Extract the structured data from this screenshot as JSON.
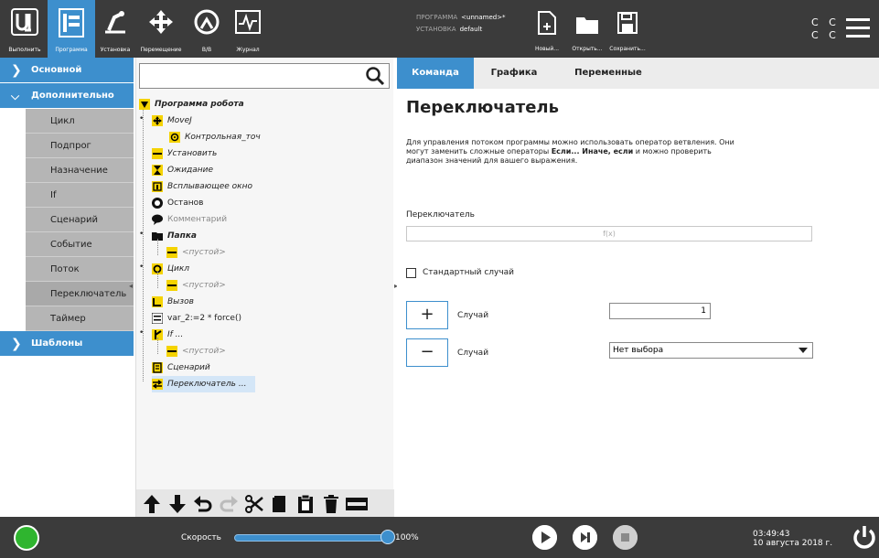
{
  "topnav": {
    "items": [
      {
        "label": "Выполнить",
        "icon": "ur-logo-icon"
      },
      {
        "label": "Программа",
        "icon": "program-icon",
        "active": true
      },
      {
        "label": "Установка",
        "icon": "installation-icon"
      },
      {
        "label": "Перемещение",
        "icon": "move-icon"
      },
      {
        "label": "В/В",
        "icon": "io-icon"
      },
      {
        "label": "Журнал",
        "icon": "log-icon"
      }
    ],
    "program_label": "ПРОГРАММА",
    "program_value": "<unnamed>*",
    "install_label": "УСТАНОВКА",
    "install_value": "default",
    "new_label": "Новый...",
    "open_label": "Открыть...",
    "save_label": "Сохранить...",
    "cc_line1": "C C",
    "cc_line2": "C C"
  },
  "sidebar": {
    "cat_basic": "Основной",
    "cat_advanced": "Дополнительно",
    "advanced_items": [
      "Цикл",
      "Подпрог",
      "Назначение",
      "If",
      "Сценарий",
      "Событие",
      "Поток",
      "Переключатель",
      "Таймер"
    ],
    "cat_templates": "Шаблоны"
  },
  "tree": {
    "search_placeholder": "",
    "root": "Программа робота",
    "nodes": [
      "MoveJ",
      "Контрольная_точ",
      "Установить",
      "Ожидание",
      "Всплывающее окно",
      "Останов",
      "Комментарий",
      "Папка",
      "<пустой>",
      "Цикл",
      "<пустой>",
      "Вызов",
      "var_2:=2 * force()",
      "If ...",
      "<пустой>",
      "Сценарий",
      "Переключатель ..."
    ]
  },
  "right": {
    "tabs": [
      "Команда",
      "Графика",
      "Переменные"
    ],
    "title": "Переключатель",
    "description_line1": "Для управления потоком программы можно использовать оператор ветвления. Они",
    "description_line2_pre": "могут заменить сложные операторы ",
    "description_bold": "Если... Иначе, если",
    "description_line2_post": " и можно проверить",
    "description_line3": "диапазон значений для вашего выражения.",
    "switch_label": "Переключатель",
    "expression_placeholder": "f(x)",
    "default_case_label": "Стандартный случай",
    "default_case_checked": false,
    "add_case_symbol": "+",
    "add_case_label": "Случай",
    "add_case_value": "1",
    "remove_case_symbol": "−",
    "remove_case_label": "Случай",
    "remove_case_select": "Нет выбора"
  },
  "bottom": {
    "speed_label": "Скорость",
    "speed_value": "100%",
    "speed_fraction": 1.0,
    "time": "03:49:43",
    "date": "10 августа 2018 г."
  },
  "colors": {
    "accent": "#3d8fcd",
    "bar": "#3b3b3b",
    "status_green": "#2fb52f"
  }
}
